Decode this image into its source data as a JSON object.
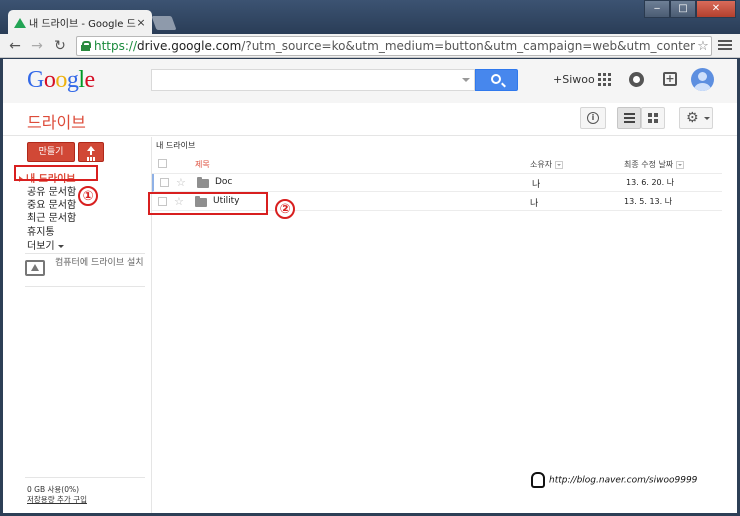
{
  "browser": {
    "tab_title": "내 드라이브 - Google 드",
    "url_proto": "https://",
    "url_host": "drive.google.com",
    "url_rest": "/?utm_source=ko&utm_medium=button&utm_campaign=web&utm_content=gotodrive"
  },
  "gbar": {
    "logo": [
      {
        "ch": "G",
        "color": "#3369e8"
      },
      {
        "ch": "o",
        "color": "#d50f25"
      },
      {
        "ch": "o",
        "color": "#eeb211"
      },
      {
        "ch": "g",
        "color": "#3369e8"
      },
      {
        "ch": "l",
        "color": "#009925"
      },
      {
        "ch": "e",
        "color": "#d50f25"
      }
    ],
    "search_value": "",
    "user_link": "+Siwoo"
  },
  "drive": {
    "title": "드라이브",
    "create_label": "만들기",
    "nav": [
      {
        "label": "내 드라이브"
      },
      {
        "label": "공유 문서함"
      },
      {
        "label": "중요 문서함"
      },
      {
        "label": "최근 문서함"
      },
      {
        "label": "휴지통"
      },
      {
        "label": "더보기"
      }
    ],
    "install_label": "컴퓨터에 드라이브 설치",
    "storage_used": "0 GB 사용(0%)",
    "storage_link": "저장용량 추가 구입"
  },
  "main": {
    "breadcrumb": "내 드라이브",
    "col_name": "제목",
    "col_owner": "소유자",
    "col_modified": "최종 수정 날짜",
    "rows": [
      {
        "name": "Doc",
        "owner": "나",
        "date": "13. 6. 20. 나"
      },
      {
        "name": "Utility",
        "owner": "나",
        "date": "13. 5. 13. 나"
      }
    ]
  },
  "annotations": {
    "n1": "①",
    "n2": "②"
  },
  "watermark": "http://blog.naver.com/siwoo9999",
  "colors": {
    "accent": "#dd4b39",
    "annotation": "#d81f1f",
    "search_blue": "#4787ed"
  }
}
